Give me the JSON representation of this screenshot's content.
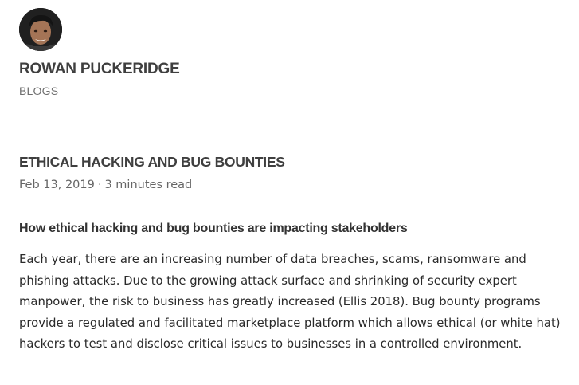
{
  "header": {
    "avatar_icon": "profile-photo",
    "site_title": "ROWAN PUCKERIDGE",
    "nav_blogs": "BLOGS"
  },
  "post": {
    "title": "ETHICAL HACKING AND BUG BOUNTIES",
    "date": "Feb 13, 2019",
    "meta_separator": "·",
    "read_time": "3 minutes read",
    "subtitle": "How ethical hacking and bug bounties are impacting stakeholders",
    "paragraph": "Each year, there are an increasing number of data breaches, scams, ransomware and phishing attacks. Due to the growing attack surface and shrinking of security expert manpower, the risk to business has greatly increased (Ellis 2018). Bug bounty programs provide a regulated and facilitated marketplace platform which allows ethical (or white hat) hackers to test and disclose critical issues to businesses in a controlled environment."
  },
  "colors": {
    "title_text": "#3f3f3f",
    "nav_text": "#6f6f6f",
    "body_text": "#2a2a2a",
    "background": "#ffffff"
  }
}
